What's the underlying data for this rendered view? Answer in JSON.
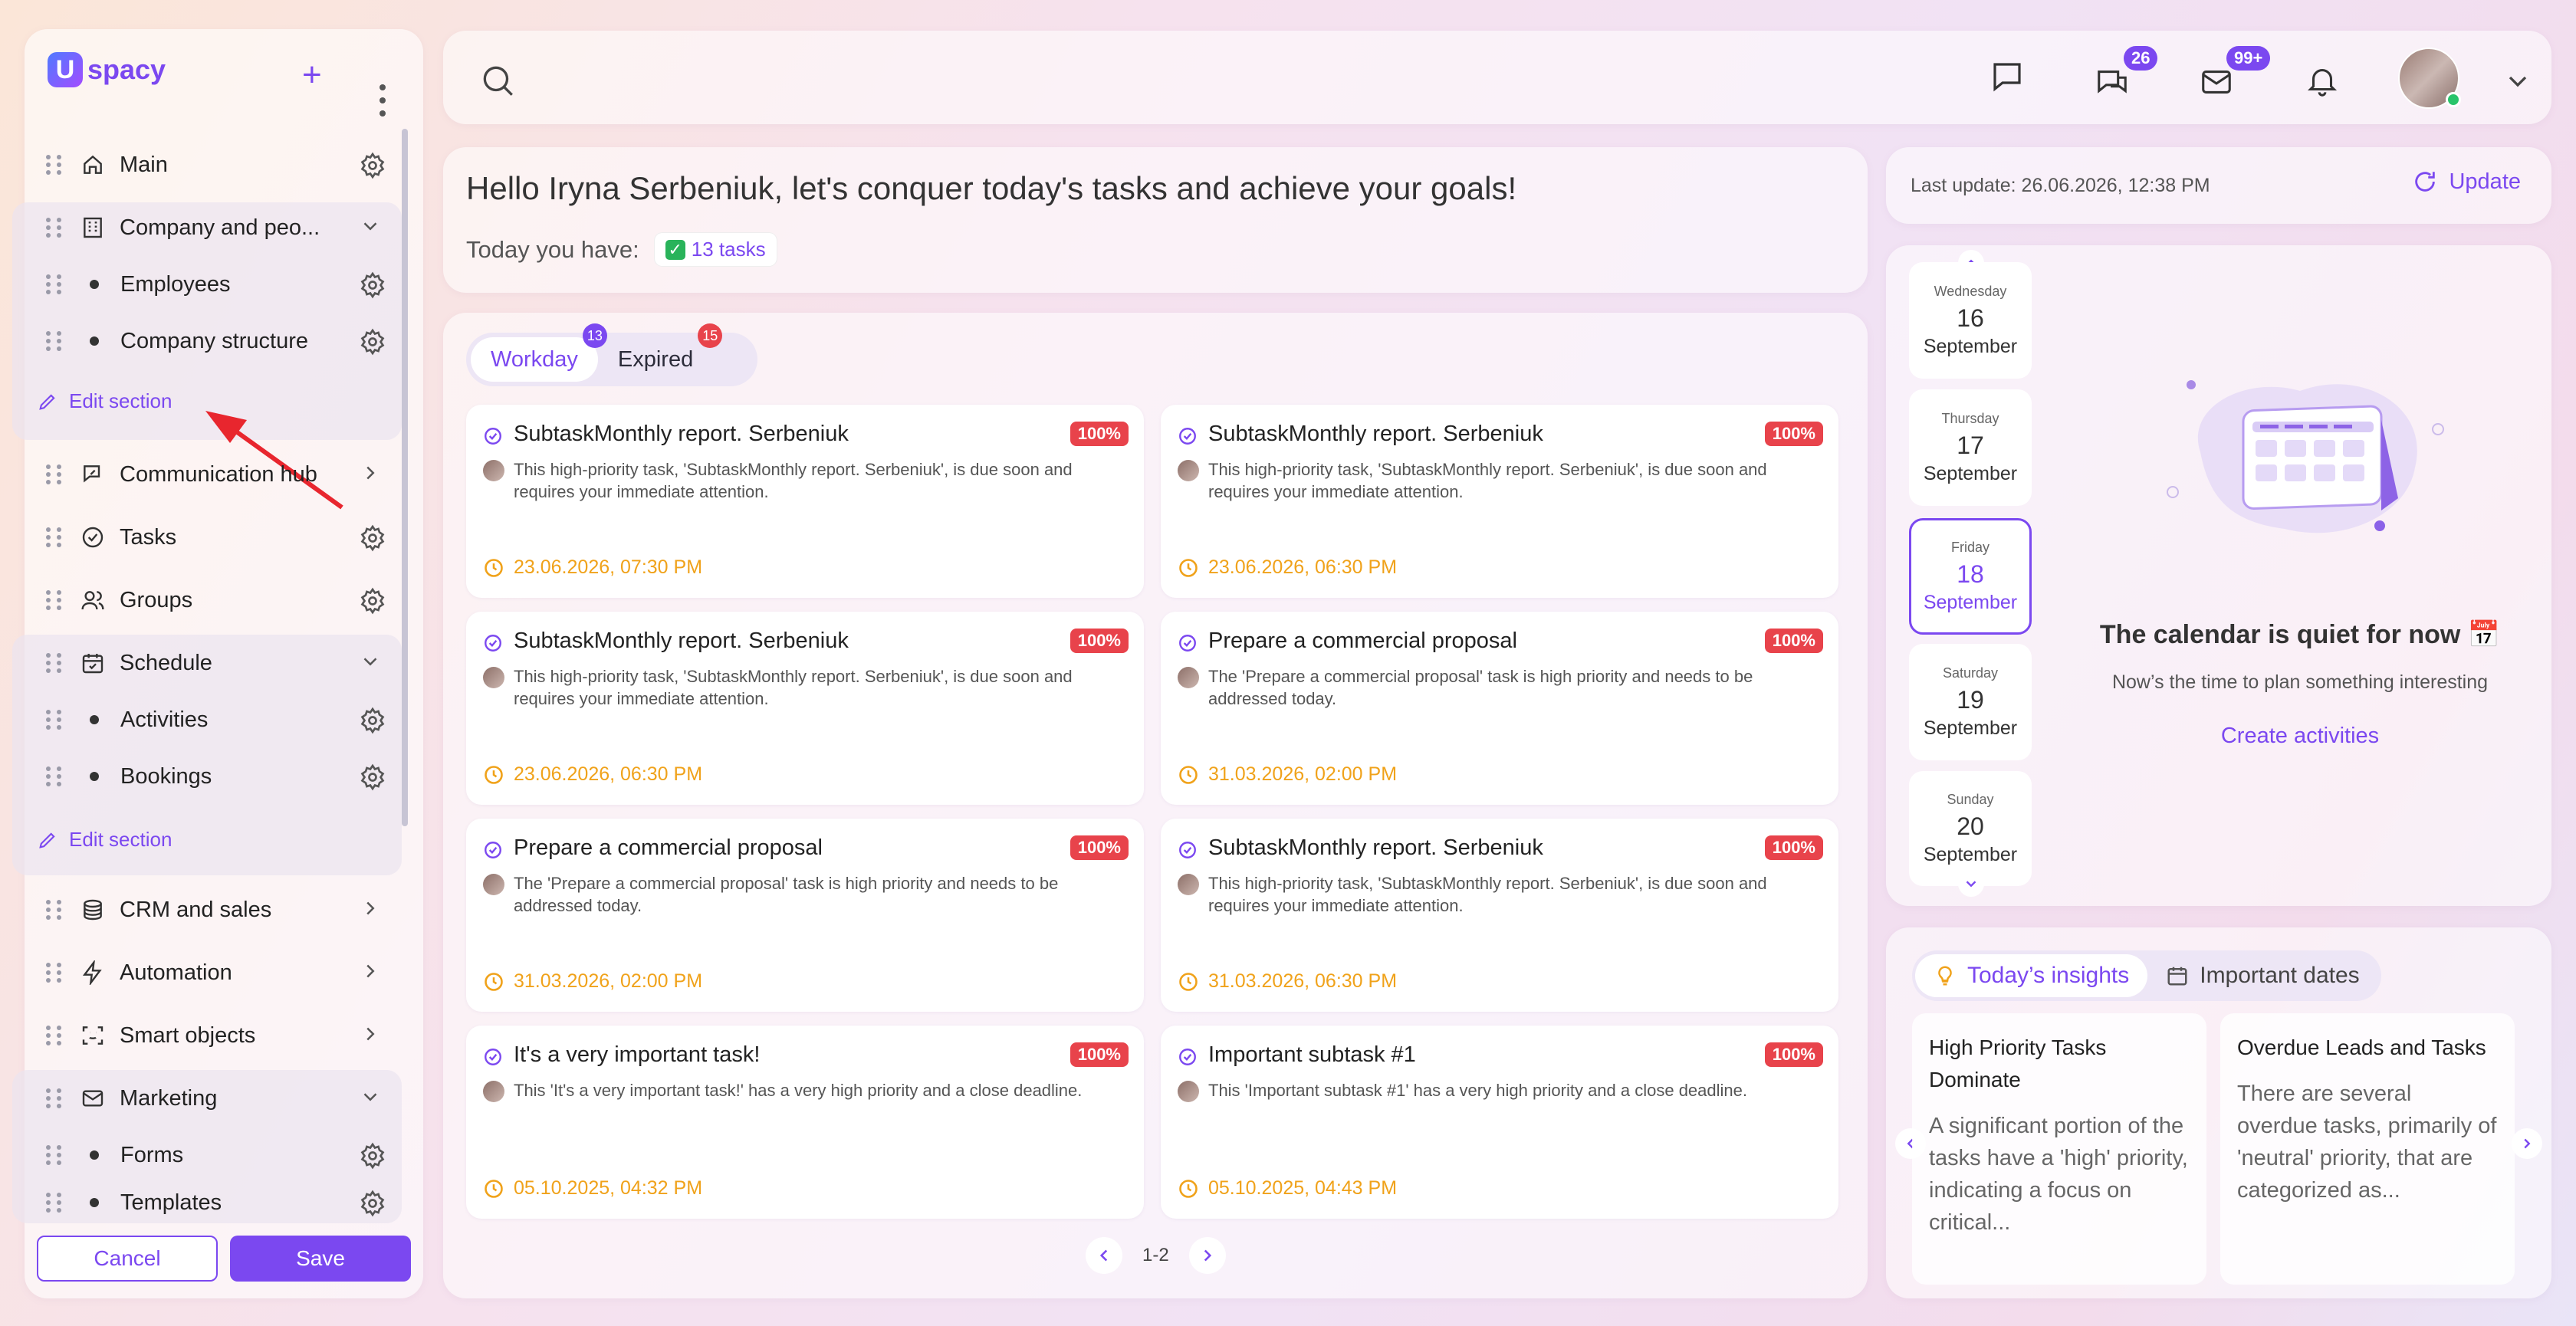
{
  "app": {
    "logo_letter": "U",
    "logo_text": "spacy"
  },
  "sidebar": {
    "items": [
      {
        "label": "Main"
      },
      {
        "label": "Company and peo..."
      },
      {
        "label": "Employees"
      },
      {
        "label": "Company structure"
      },
      {
        "label": "Communication hub"
      },
      {
        "label": "Tasks"
      },
      {
        "label": "Groups"
      },
      {
        "label": "Schedule"
      },
      {
        "label": "Activities"
      },
      {
        "label": "Bookings"
      },
      {
        "label": "CRM and sales"
      },
      {
        "label": "Automation"
      },
      {
        "label": "Smart objects"
      },
      {
        "label": "Marketing"
      },
      {
        "label": "Forms"
      },
      {
        "label": "Templates"
      }
    ],
    "edit_section": "Edit section",
    "cancel": "Cancel",
    "save": "Save"
  },
  "topbar": {
    "chat_badge": "26",
    "mail_badge": "99+"
  },
  "greeting": {
    "title": "Hello Iryna Serbeniuk, let's conquer today's tasks and achieve your goals!",
    "today_label": "Today you have:",
    "tasks_chip": "13 tasks"
  },
  "tasks": {
    "tabs": [
      {
        "label": "Workday",
        "badge": "13",
        "active": true
      },
      {
        "label": "Expired",
        "badge": "15",
        "active": false
      }
    ],
    "cards": [
      {
        "title": "SubtaskMonthly report. Serbeniuk",
        "priority": "100%",
        "desc": "This high-priority task, 'SubtaskMonthly report. Serbeniuk', is due soon and requires your immediate attention.",
        "date": "23.06.2026, 07:30 PM"
      },
      {
        "title": "SubtaskMonthly report. Serbeniuk",
        "priority": "100%",
        "desc": "This high-priority task, 'SubtaskMonthly report. Serbeniuk', is due soon and requires your immediate attention.",
        "date": "23.06.2026, 06:30 PM"
      },
      {
        "title": "SubtaskMonthly report. Serbeniuk",
        "priority": "100%",
        "desc": "This high-priority task, 'SubtaskMonthly report. Serbeniuk', is due soon and requires your immediate attention.",
        "date": "23.06.2026, 06:30 PM"
      },
      {
        "title": "Prepare a commercial proposal",
        "priority": "100%",
        "desc": "The 'Prepare a commercial proposal' task is high priority and needs to be addressed today.",
        "date": "31.03.2026, 02:00 PM"
      },
      {
        "title": "Prepare a commercial proposal",
        "priority": "100%",
        "desc": "The 'Prepare a commercial proposal' task is high priority and needs to be addressed today.",
        "date": "31.03.2026, 02:00 PM"
      },
      {
        "title": "SubtaskMonthly report. Serbeniuk",
        "priority": "100%",
        "desc": "This high-priority task, 'SubtaskMonthly report. Serbeniuk', is due soon and requires your immediate attention.",
        "date": "31.03.2026, 06:30 PM"
      },
      {
        "title": "It's a very important task!",
        "priority": "100%",
        "desc": "This 'It's a very important task!' has a very high priority and a close deadline.",
        "date": "05.10.2025, 04:32 PM"
      },
      {
        "title": "Important subtask #1",
        "priority": "100%",
        "desc": "This 'Important subtask #1' has a very high priority and a close deadline.",
        "date": "05.10.2025, 04:43 PM"
      }
    ],
    "pagination": "1-2"
  },
  "update": {
    "last_update": "Last update: 26.06.2026, 12:38 PM",
    "button": "Update"
  },
  "calendar": {
    "days": [
      {
        "weekday": "Wednesday",
        "day": "16",
        "month": "September",
        "selected": false
      },
      {
        "weekday": "Thursday",
        "day": "17",
        "month": "September",
        "selected": false
      },
      {
        "weekday": "Friday",
        "day": "18",
        "month": "September",
        "selected": true
      },
      {
        "weekday": "Saturday",
        "day": "19",
        "month": "September",
        "selected": false
      },
      {
        "weekday": "Sunday",
        "day": "20",
        "month": "September",
        "selected": false
      }
    ],
    "empty_title": "The calendar is quiet for now 📅",
    "empty_sub": "Now’s the time to plan something interesting",
    "create": "Create activities"
  },
  "insights": {
    "tabs": [
      "Today’s insights",
      "Important dates"
    ],
    "cards": [
      {
        "title": "High Priority Tasks Dominate",
        "text": "A significant portion of the tasks have a 'high' priority, indicating a focus on critical..."
      },
      {
        "title": "Overdue Leads and Tasks",
        "text": "There are several overdue tasks, primarily of 'neutral' priority, that are categorized as..."
      }
    ]
  },
  "colors": {
    "accent": "#7b48f0",
    "priority": "#e8434b",
    "date": "#f0a21a"
  }
}
